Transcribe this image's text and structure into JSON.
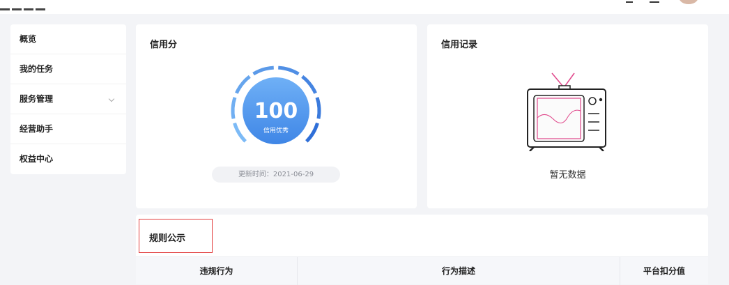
{
  "sidebar": {
    "items": [
      {
        "label": "概览"
      },
      {
        "label": "我的任务"
      },
      {
        "label": "服务管理"
      },
      {
        "label": "经营助手"
      },
      {
        "label": "权益中心"
      }
    ]
  },
  "credit": {
    "title": "信用分",
    "score": "100",
    "level": "信用优秀",
    "score_fraction": 1.0,
    "update_text": "更新时间：2021-06-29"
  },
  "record": {
    "title": "信用记录",
    "empty_text": "暂无数据"
  },
  "rules": {
    "title": "规则公示",
    "columns": [
      "违规行为",
      "行为描述",
      "平台扣分值"
    ]
  },
  "colors": {
    "accent": "#4a8fe8",
    "gauge_light": "#6fb0f4",
    "gauge_dark": "#2f6fd8",
    "highlight_border": "#e23d3d",
    "tv_screen": "#e0468a"
  }
}
